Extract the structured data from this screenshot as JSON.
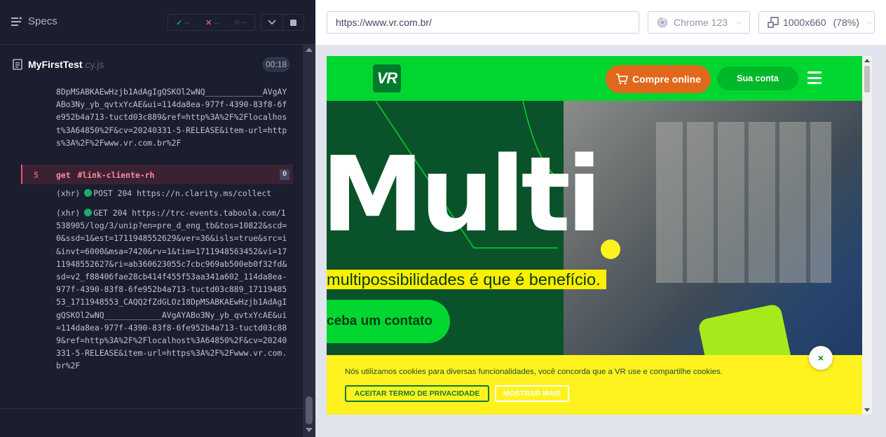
{
  "reporter": {
    "specs_label": "Specs",
    "stats": {
      "passed": "--",
      "failed": "--",
      "pending": "--"
    },
    "spec": {
      "name": "MyFirstTest",
      "ext": ".cy.js",
      "duration": "00:18"
    },
    "log_top": "8DpMSABKAEwHzjb1AdAgIgQSKOl2wNQ____________AVgAYABo3Ny_yb_qvtxYcAE&ui=114da8ea-977f-4390-83f8-6fe952b4a713-tuctd03c889&ref=http%3A%2F%2Flocalhost%3A64850%2F&cv=20240331-5-RELEASE&item-url=https%3A%2F%2Fwww.vr.com.br%2F",
    "command": {
      "number": "5",
      "name": "get",
      "selector": "#link-cliente-rh",
      "badge": "0"
    },
    "xhr1": {
      "tag": "(xhr)",
      "text": "POST 204 https://n.clarity.ms/collect"
    },
    "xhr2": {
      "tag": "(xhr)",
      "text": "GET 204 https://trc-events.taboola.com/1538905/log/3/unip?en=pre_d_eng_tb&tos=10822&scd=0&ssd=1&est=1711948552629&ver=36&isls=true&src=i&invt=6000&msa=7420&rv=1&tim=1711948563452&vi=1711948552627&ri=ab360623055c7cbc969ab500eb0f32fd&sd=v2_f88406fae28cb414f455f53aa341a602_114da8ea-977f-4390-83f8-6fe952b4a713-tuctd03c889_1711948553_1711948553_CAQQ2fZdGLOz18DpMSABKAEwHzjb1AdAgIgQSKOl2wNQ____________AVgAYABo3Ny_yb_qvtxYcAE&ui=114da8ea-977f-4390-83f8-6fe952b4a713-tuctd03c889&ref=http%3A%2F%2Flocalhost%3A64850%2F&cv=20240331-5-RELEASE&item-url=https%3A%2F%2Fwww.vr.com.br%2F"
    }
  },
  "aut": {
    "url": "https://www.vr.com.br/",
    "browser": "Chrome 123",
    "viewport": "1000x660",
    "viewport_scale": "(78%)"
  },
  "site": {
    "logo_text": "VR",
    "buy_button": "Compre online",
    "account_button": "Sua conta",
    "hero_title": "Multi",
    "hero_tagline": "multipossibilidades é que é benefício.",
    "hero_cta": "ceba um contato",
    "cookie_text": "Nós utilizamos cookies para diversas funcionalidades, você concorda que a VR use e compartilhe cookies.",
    "cookie_accept": "ACEITAR TERMO DE PRIVACIDADE",
    "cookie_more": "MOSTRAR MAIS",
    "cookie_close": "×"
  },
  "colors": {
    "reporter_bg": "#1b1e2e",
    "fail_accent": "#e45770",
    "pass_accent": "#1fa971",
    "site_green": "#00d62f",
    "site_yellow": "#fff21f",
    "site_orange": "#e0681a"
  },
  "icons": [
    "specs-menu-icon",
    "check-icon",
    "x-icon",
    "spinner-icon",
    "chevron-down-icon",
    "stop-icon",
    "file-icon",
    "chrome-icon",
    "viewport-icon",
    "cart-icon",
    "hamburger-icon",
    "close-icon"
  ]
}
